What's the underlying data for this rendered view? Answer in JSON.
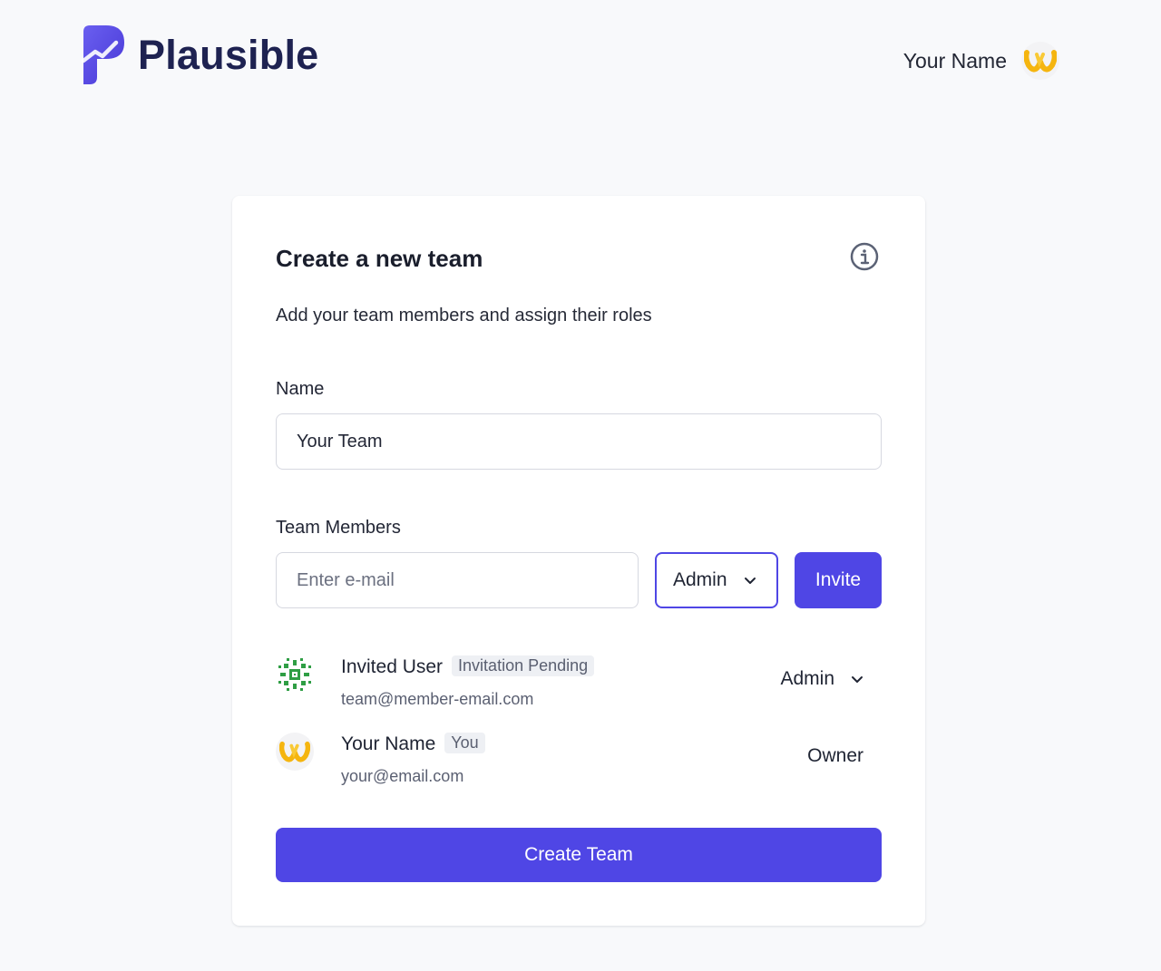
{
  "app": {
    "name": "Plausible"
  },
  "header": {
    "user_name": "Your Name"
  },
  "form": {
    "title": "Create a new team",
    "subtitle": "Add your team members and assign their roles",
    "name_label": "Name",
    "name_value": "Your Team",
    "members_label": "Team Members",
    "email_placeholder": "Enter e-mail",
    "role_value": "Admin",
    "invite_label": "Invite",
    "submit_label": "Create Team"
  },
  "members": [
    {
      "name": "Invited User",
      "badge": "Invitation Pending",
      "email": "team@member-email.com",
      "role": "Admin",
      "role_editable": true,
      "avatar": "pattern-avatar-icon"
    },
    {
      "name": "Your Name",
      "badge": "You",
      "email": "your@email.com",
      "role": "Owner",
      "role_editable": false,
      "avatar": "waving-hands-icon"
    }
  ],
  "colors": {
    "accent": "#4f46e5",
    "brand_text": "#1e2251",
    "background": "#f8f9fb"
  }
}
